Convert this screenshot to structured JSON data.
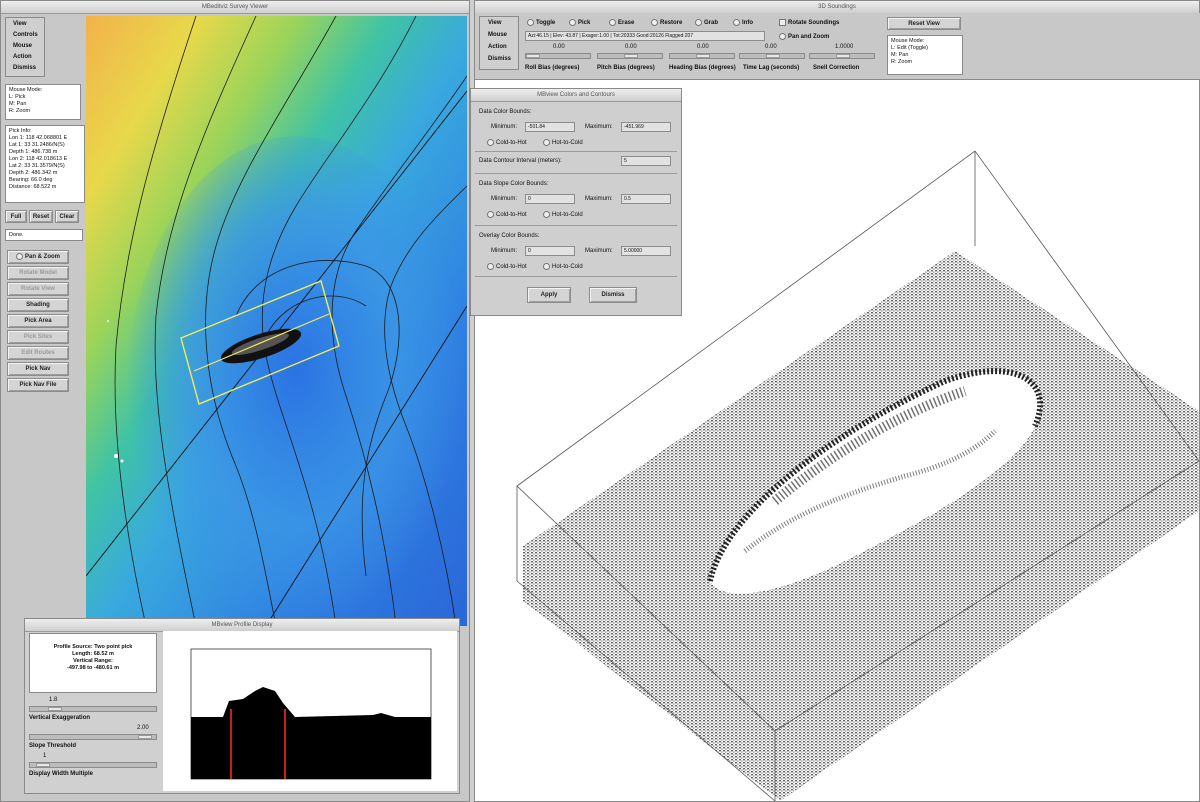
{
  "survey_window": {
    "title": "MBeditviz Survey Viewer",
    "menu": [
      "View",
      "Controls",
      "Mouse",
      "Action",
      "Dismiss"
    ],
    "mouse_mode": [
      "Mouse Mode:",
      "L: Pick",
      "M: Pan",
      "R: Zoom"
    ],
    "pick_info": [
      "Pick Info:",
      "Lon 1: 118  42.068801 E",
      "Lat 1: 33  31.2486/N(S)",
      "Depth 1: 486.738 m",
      "Lon 2: 118  42.018613 E",
      "Lat 2: 33  31.3579/N(S)",
      "Depth 2: 486.342 m",
      "Bearing: 66.0 deg",
      "Distance: 68.522 m"
    ],
    "buttons": {
      "full": "Full",
      "reset": "Reset",
      "clear": "Clear"
    },
    "status": "Done.",
    "actions": [
      {
        "label": "Pan & Zoom",
        "enabled": true
      },
      {
        "label": "Rotate Model",
        "enabled": false
      },
      {
        "label": "Rotate View",
        "enabled": false
      },
      {
        "label": "Shading",
        "enabled": true
      },
      {
        "label": "Pick Area",
        "enabled": true
      },
      {
        "label": "Pick Sites",
        "enabled": false
      },
      {
        "label": "Edit Routes",
        "enabled": false
      },
      {
        "label": "Pick Nav",
        "enabled": true
      },
      {
        "label": "Pick Nav File",
        "enabled": true
      }
    ]
  },
  "profile_window": {
    "title": "MBview Profile Display",
    "info": [
      "Profile Source: Two point pick",
      "Length: 68.52 m",
      "Vertical Range:",
      "-497.98 to -480.61 m"
    ],
    "slider1_value": "1.8",
    "vertical_exaggeration_label": "Vertical Exaggeration",
    "vertical_exaggeration_value": "2.00",
    "slope_threshold_label": "Slope Threshold",
    "slope_threshold_value": "1",
    "display_width_label": "Display Width Multiple"
  },
  "soundings_window": {
    "title": "3D Soundings",
    "menu": [
      "View",
      "Mouse",
      "Action",
      "Dismiss"
    ],
    "modes": [
      "Toggle",
      "Pick",
      "Erase",
      "Restore",
      "Grab",
      "Info"
    ],
    "rotate_soundings": "Rotate Soundings",
    "pan_zoom": "Pan and Zoom",
    "reset_view": "Reset View",
    "info_field": "Azi:46.15 | Elev: 43.87 | Exager:1.00 | Tot:20333 Good:20126 Flagged:207",
    "bias_values": [
      "0.00",
      "0.00",
      "0.00",
      "0.00",
      "1.0000"
    ],
    "bias_labels": [
      "Roll Bias (degrees)",
      "Pitch Bias (degrees)",
      "Heading Bias (degrees)",
      "Time Lag (seconds)",
      "Snell Correction"
    ],
    "mouse_mode": [
      "Mouse Mode:",
      "L: Edit (Toggle)",
      "M: Pan",
      "R: Zoom"
    ]
  },
  "colors_window": {
    "title": "MBview Colors and Contours",
    "data_color_bounds": "Data Color Bounds:",
    "minimum_label": "Minimum:",
    "maximum_label": "Maximum:",
    "data_min": "-501.84",
    "data_max": "-451.969",
    "cold_to_hot": "Cold-to-Hot",
    "hot_to_cold": "Hot-to-Cold",
    "contour_interval_label": "Data Contour Interval (meters):",
    "contour_interval": "5",
    "slope_color_bounds": "Data Slope Color Bounds:",
    "slope_min": "0",
    "slope_max": "0.5",
    "overlay_color_bounds": "Overlay Color Bounds:",
    "overlay_min": "0",
    "overlay_max": "5.00000",
    "apply": "Apply",
    "dismiss": "Dismiss"
  }
}
